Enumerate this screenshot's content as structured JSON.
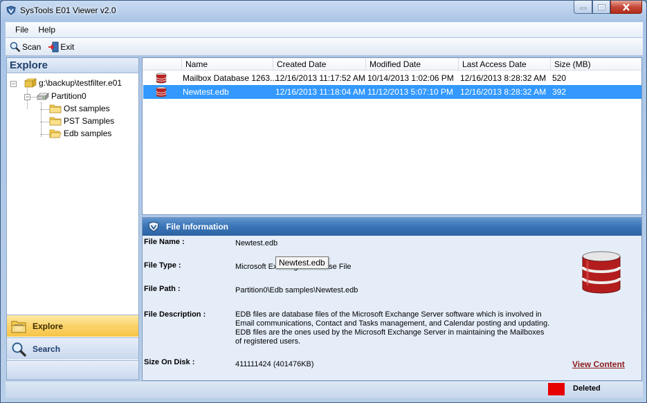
{
  "window": {
    "title": "SysTools E01 Viewer v2.0"
  },
  "menu": {
    "file": "File",
    "help": "Help"
  },
  "toolbar": {
    "scan": "Scan",
    "exit": "Exit"
  },
  "explore": {
    "header": "Explore",
    "tree": {
      "root": "g:\\backup\\testfilter.e01",
      "partition": "Partition0",
      "folders": [
        "Ost samples",
        "PST Samples",
        "Edb samples"
      ]
    },
    "nav_explore": "Explore",
    "nav_search": "Search",
    "splitter": "....."
  },
  "file_list": {
    "columns": [
      "Name",
      "Created Date",
      "Modified Date",
      "Last Access Date",
      "Size (MB)"
    ],
    "rows": [
      {
        "name": "Mailbox Database 1263...",
        "created": "12/16/2013 11:17:52 AM",
        "modified": "10/14/2013 1:02:06 PM",
        "accessed": "12/16/2013 8:28:32 AM",
        "size": "520",
        "selected": false
      },
      {
        "name": "Newtest.edb",
        "created": "12/16/2013 11:18:04 AM",
        "modified": "11/12/2013 5:07:10 PM",
        "accessed": "12/16/2013 8:28:32 AM",
        "size": "392",
        "selected": true
      }
    ]
  },
  "file_info": {
    "header": "File Information",
    "labels": {
      "name": "File Name :",
      "type": "File Type :",
      "path": "File Path :",
      "description": "File Description :",
      "size": "Size On Disk :"
    },
    "values": {
      "name": "Newtest.edb",
      "type": "Microsoft Exchange Database File",
      "path": "Partition0\\Edb samples\\Newtest.edb",
      "description": "EDB files are database files of the Microsoft Exchange Server software which is involved in Email communications, Contact and Tasks management, and Calendar posting and updating. EDB files are the ones used by the Microsoft Exchange Server in maintaining the Mailboxes of registered users.",
      "size": "411111424 (401476KB)"
    },
    "tooltip": "Newtest.edb",
    "view_content": "View Content"
  },
  "status": {
    "legend_deleted": "Deleted",
    "deleted_color": "#e60000"
  }
}
